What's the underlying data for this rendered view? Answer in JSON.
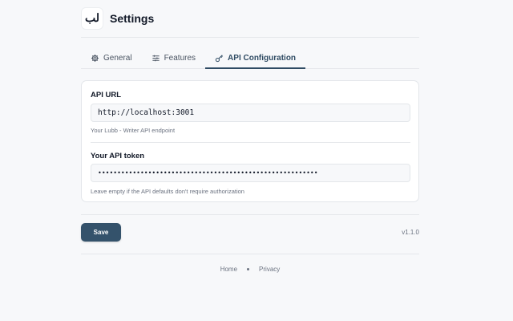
{
  "header": {
    "logo_text": "لب",
    "title": "Settings"
  },
  "tabs": [
    {
      "label": "General",
      "icon": "gear-icon",
      "active": false
    },
    {
      "label": "Features",
      "icon": "sliders-icon",
      "active": false
    },
    {
      "label": "API Configuration",
      "icon": "key-icon",
      "active": true
    }
  ],
  "api_url": {
    "label": "API URL",
    "value": "http://localhost:3001",
    "help": "Your Lubb - Writer API endpoint"
  },
  "api_token": {
    "label": "Your API token",
    "value": "•••••••••••••••••••••••••••••••••••••••••••••••••••••••••",
    "help": "Leave empty if the API defaults don't require authorization"
  },
  "actions": {
    "save_label": "Save",
    "version": "v1.1.0"
  },
  "footer": {
    "links": [
      "Home",
      "Privacy"
    ]
  },
  "colors": {
    "accent": "#34526b",
    "background": "#f7f8fa"
  }
}
